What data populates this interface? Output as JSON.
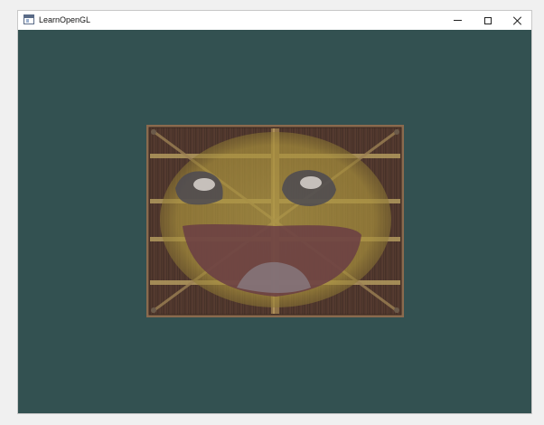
{
  "window": {
    "title": "LearnOpenGL",
    "controls": {
      "minimize": "minimize",
      "maximize": "maximize",
      "close": "close"
    }
  },
  "viewport": {
    "clear_color": "#335151",
    "content": "textured-quad",
    "textures": [
      "wooden-container",
      "awesome-face"
    ]
  }
}
